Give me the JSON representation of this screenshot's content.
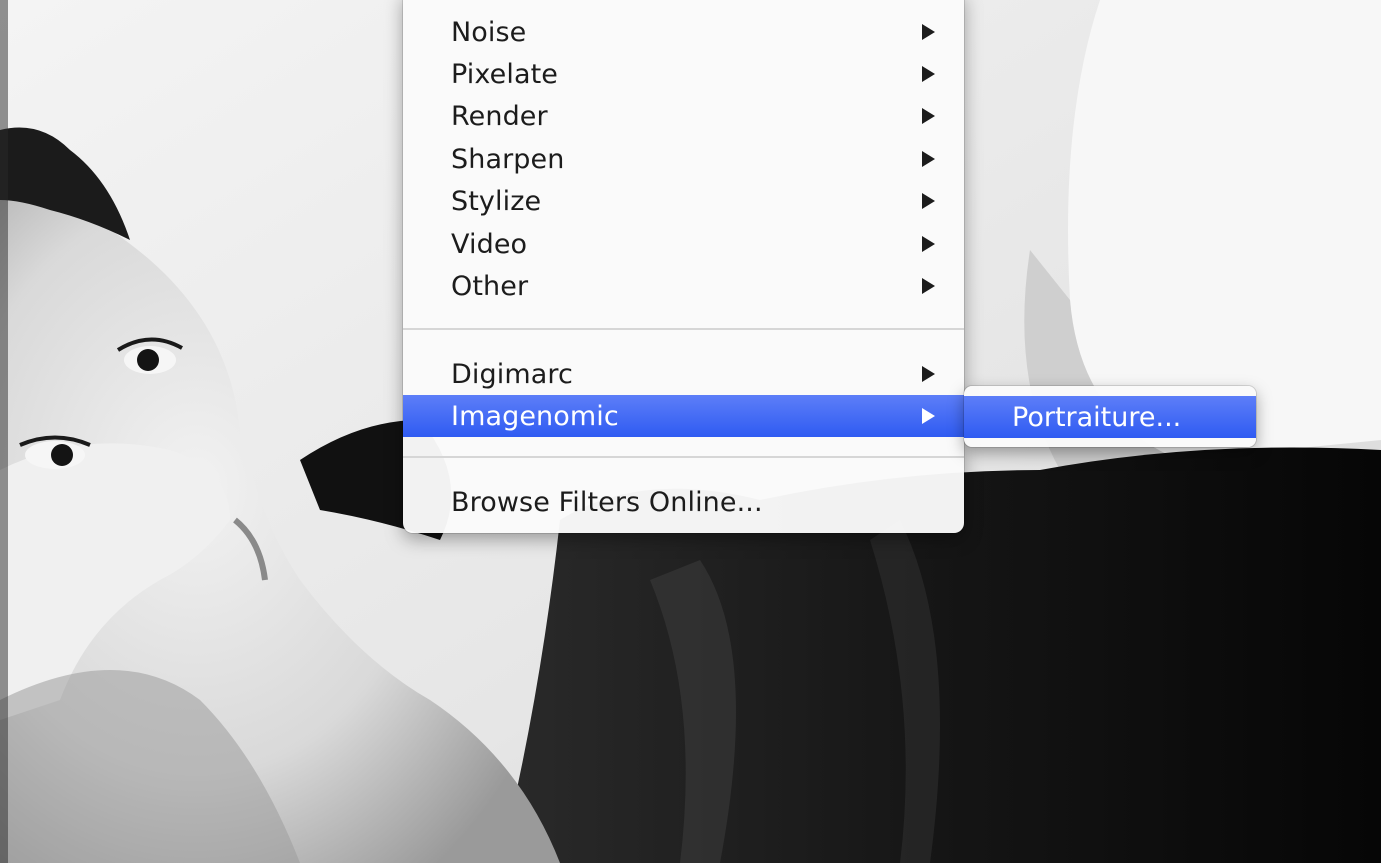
{
  "menu": {
    "items": [
      {
        "label": "Noise",
        "has_submenu": true
      },
      {
        "label": "Pixelate",
        "has_submenu": true
      },
      {
        "label": "Render",
        "has_submenu": true
      },
      {
        "label": "Sharpen",
        "has_submenu": true
      },
      {
        "label": "Stylize",
        "has_submenu": true
      },
      {
        "label": "Video",
        "has_submenu": true
      },
      {
        "label": "Other",
        "has_submenu": true
      },
      {
        "label": "Digimarc",
        "has_submenu": true
      },
      {
        "label": "Imagenomic",
        "has_submenu": true,
        "highlighted": true
      },
      {
        "label": "Browse Filters Online...",
        "has_submenu": false
      }
    ]
  },
  "submenu": {
    "items": [
      {
        "label": "Portraiture...",
        "highlighted": true
      }
    ]
  },
  "colors": {
    "highlight": "#3a63f4",
    "menu_bg": "#fafafa",
    "text": "#1c1c1c"
  },
  "icons": {
    "submenu_arrow": "triangle-right-icon"
  }
}
